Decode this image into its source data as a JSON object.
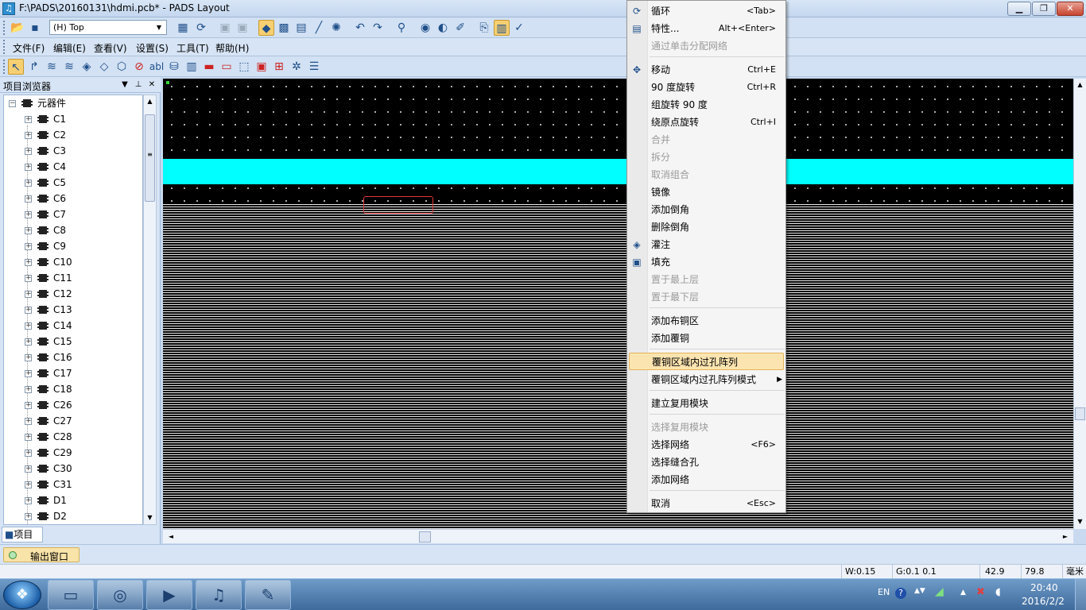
{
  "window": {
    "title": "F:\\PADS\\20160131\\hdmi.pcb* - PADS Layout",
    "app_icon_glyph": "♫",
    "min_glyph": "▁",
    "max_glyph": "❐",
    "close_glyph": "✕"
  },
  "toolbar1": {
    "layer_value": "(H) Top",
    "dropdown_arrow": "▼",
    "icons": [
      "open-folder-icon",
      "save-icon",
      "print-icon",
      "refresh-icon",
      "layer-icon-1",
      "layer-icon-2",
      "design-mode-icon",
      "route-icon",
      "pour-icon",
      "draw-line-icon",
      "ratsnest-icon",
      "undo-icon",
      "redo-icon",
      "zoom-icon",
      "view-nets-icon",
      "push-icon",
      "clean-icon",
      "output-icon",
      "layout-icon",
      "check-icon"
    ]
  },
  "menubar": {
    "items": [
      "文件(F)",
      "编辑(E)",
      "查看(V)",
      "设置(S)",
      "工具(T)",
      "帮助(H)"
    ]
  },
  "browser": {
    "title": "项目浏览器",
    "root_label": "元器件",
    "items": [
      "C1",
      "C2",
      "C3",
      "C4",
      "C5",
      "C6",
      "C7",
      "C8",
      "C9",
      "C10",
      "C11",
      "C12",
      "C13",
      "C14",
      "C15",
      "C16",
      "C17",
      "C18",
      "C26",
      "C27",
      "C28",
      "C29",
      "C30",
      "C31",
      "D1",
      "D2"
    ],
    "tab_label": "项目",
    "pin_glyph": "⊥",
    "close_glyph": "✕",
    "menu_glyph": "▼",
    "expand_glyph": "+",
    "collapse_glyph": "−",
    "scroll_up": "▲",
    "scroll_down": "▼",
    "thumb_grip": "≡"
  },
  "canvas": {
    "band_color": "#00ffff",
    "background_color": "#000000",
    "scroll_left": "◄",
    "scroll_right": "►",
    "scroll_up": "▲",
    "scroll_down": "▼"
  },
  "output": {
    "tab_label": "输出窗口"
  },
  "status": {
    "width": "W:0.15",
    "grid": "G:0.1 0.1",
    "x": "42.9",
    "y": "79.8",
    "units": "毫米"
  },
  "context_menu": {
    "items": [
      {
        "label": "循环",
        "shortcut": "<Tab>",
        "icon": "cycle-icon",
        "glyph": "⟳",
        "enabled": true
      },
      {
        "label": "特性...",
        "shortcut": "Alt+<Enter>",
        "icon": "properties-icon",
        "glyph": "▤",
        "enabled": true
      },
      {
        "label": "通过单击分配网络",
        "shortcut": "",
        "icon": "",
        "glyph": "",
        "enabled": false
      },
      {
        "label": "移动",
        "shortcut": "Ctrl+E",
        "icon": "move-icon",
        "glyph": "✥",
        "enabled": true
      },
      {
        "label": "90 度旋转",
        "shortcut": "Ctrl+R",
        "icon": "",
        "glyph": "",
        "enabled": true
      },
      {
        "label": "组旋转 90 度",
        "shortcut": "",
        "icon": "",
        "glyph": "",
        "enabled": true
      },
      {
        "label": "绕原点旋转",
        "shortcut": "Ctrl+I",
        "icon": "",
        "glyph": "",
        "enabled": true
      },
      {
        "label": "合并",
        "shortcut": "",
        "icon": "",
        "glyph": "",
        "enabled": false
      },
      {
        "label": "拆分",
        "shortcut": "",
        "icon": "",
        "glyph": "",
        "enabled": false
      },
      {
        "label": "取消组合",
        "shortcut": "",
        "icon": "",
        "glyph": "",
        "enabled": false
      },
      {
        "label": "镜像",
        "shortcut": "",
        "icon": "",
        "glyph": "",
        "enabled": true
      },
      {
        "label": "添加倒角",
        "shortcut": "",
        "icon": "",
        "glyph": "",
        "enabled": true
      },
      {
        "label": "删除倒角",
        "shortcut": "",
        "icon": "",
        "glyph": "",
        "enabled": true
      },
      {
        "label": "灌注",
        "shortcut": "",
        "icon": "pour-icon",
        "glyph": "◈",
        "enabled": true
      },
      {
        "label": "填充",
        "shortcut": "",
        "icon": "fill-icon",
        "glyph": "▣",
        "enabled": true
      },
      {
        "label": "置于最上层",
        "shortcut": "",
        "icon": "",
        "glyph": "",
        "enabled": false
      },
      {
        "label": "置于最下层",
        "shortcut": "",
        "icon": "",
        "glyph": "",
        "enabled": false
      },
      {
        "label": "添加布铜区",
        "shortcut": "",
        "icon": "",
        "glyph": "",
        "enabled": true
      },
      {
        "label": "添加覆铜",
        "shortcut": "",
        "icon": "",
        "glyph": "",
        "enabled": true
      },
      {
        "label": "覆铜区域内过孔阵列",
        "shortcut": "",
        "icon": "",
        "glyph": "",
        "enabled": true,
        "highlight": true
      },
      {
        "label": "覆铜区域内过孔阵列模式",
        "shortcut": "",
        "icon": "",
        "glyph": "",
        "enabled": true,
        "submenu": true
      },
      {
        "label": "建立复用模块",
        "shortcut": "",
        "icon": "",
        "glyph": "",
        "enabled": true
      },
      {
        "label": "选择复用模块",
        "shortcut": "",
        "icon": "",
        "glyph": "",
        "enabled": false
      },
      {
        "label": "选择网络",
        "shortcut": "<F6>",
        "icon": "",
        "glyph": "",
        "enabled": true
      },
      {
        "label": "选择缝合孔",
        "shortcut": "",
        "icon": "",
        "glyph": "",
        "enabled": true
      },
      {
        "label": "添加网络",
        "shortcut": "",
        "icon": "",
        "glyph": "",
        "enabled": true
      },
      {
        "label": "取消",
        "shortcut": "<Esc>",
        "icon": "",
        "glyph": "",
        "enabled": true
      }
    ],
    "submenu_arrow": "▶"
  },
  "taskbar": {
    "start_glyph": "❖",
    "apps": [
      {
        "name": "explorer-task",
        "icon": "folder-icon",
        "glyph": "▭"
      },
      {
        "name": "browser-task",
        "icon": "browser-icon",
        "glyph": "◎"
      },
      {
        "name": "video-task",
        "icon": "video-icon",
        "glyph": "▶"
      },
      {
        "name": "pads-task",
        "icon": "music-note-icon",
        "glyph": "♫"
      },
      {
        "name": "paint-task",
        "icon": "palette-icon",
        "glyph": "✎"
      }
    ],
    "lang": "EN",
    "help_glyph": "?",
    "tray_arrow": "▲",
    "time": "20:40",
    "date": "2016/2/2"
  }
}
